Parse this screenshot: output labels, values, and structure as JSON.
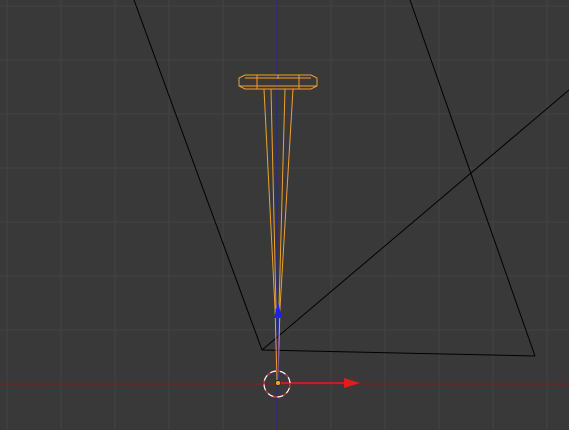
{
  "viewport": {
    "background": "#393939",
    "grid_color": "#444444",
    "x_axis_color": "#8a1b1b",
    "y_axis_color": "#2323a8",
    "wire_color": "#000000",
    "selection_color": "#f0a030",
    "cursor_color": "#ffffff",
    "manipulator": {
      "x_arrow_color": "#e31b1b",
      "z_arrow_color": "#1c24e8"
    }
  },
  "scene": {
    "selected_object": "nail-mesh",
    "cursor_icon": "3d-cursor-icon",
    "widget_icon": "transform-manipulator-icon"
  }
}
